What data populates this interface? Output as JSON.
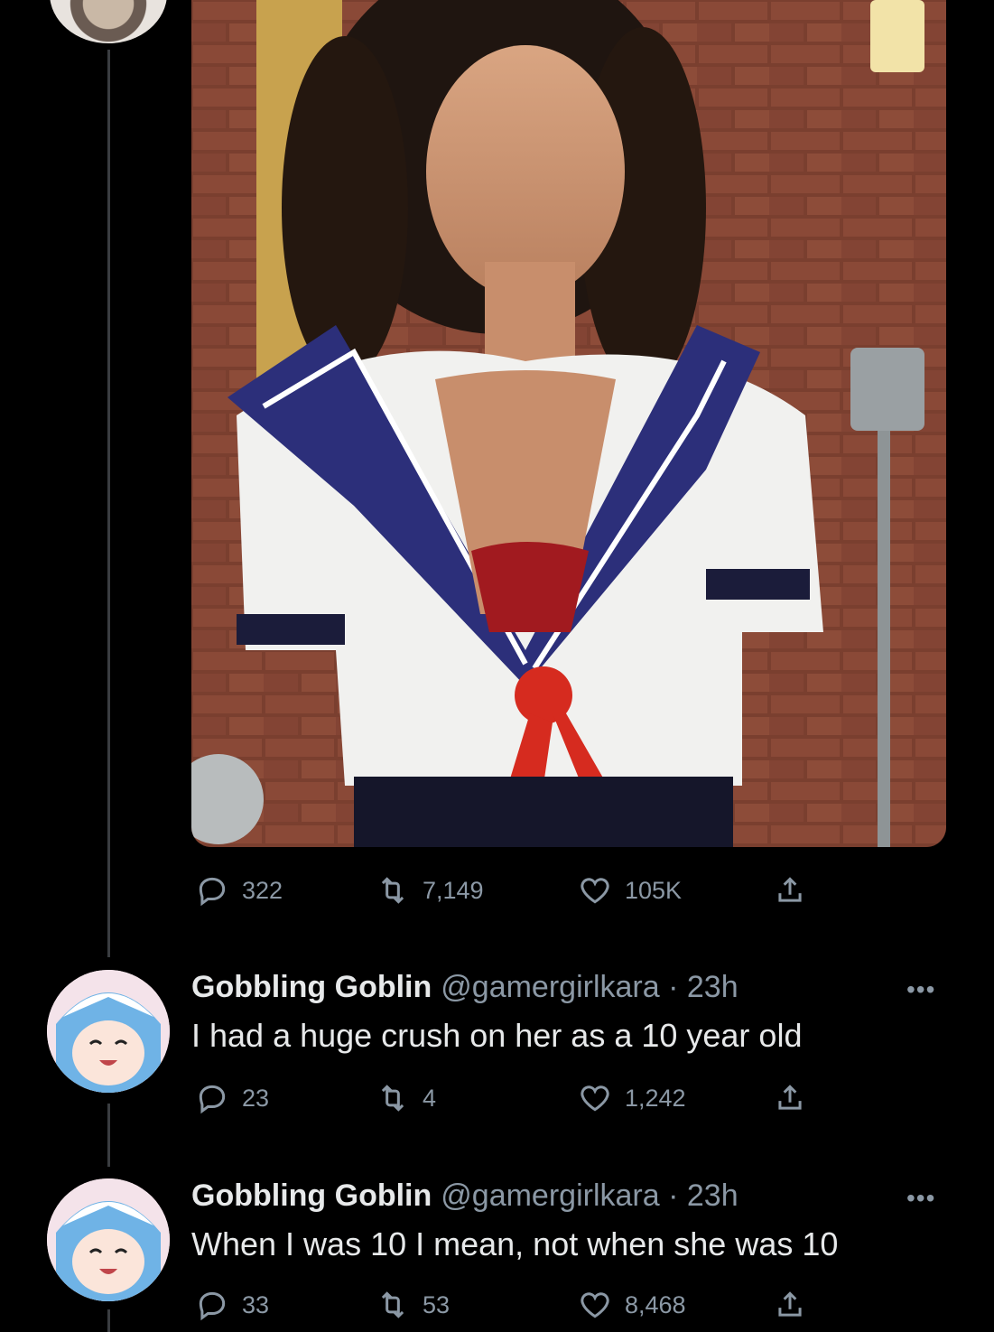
{
  "main_tweet": {
    "stats": {
      "replies": "322",
      "retweets": "7,149",
      "likes": "105K"
    }
  },
  "replies": [
    {
      "name": "Gobbling Goblin",
      "handle": "@gamergirlkara",
      "separator": "·",
      "time": "23h",
      "text": "I had a huge crush on her as a 10 year old",
      "stats": {
        "replies": "23",
        "retweets": "4",
        "likes": "1,242"
      }
    },
    {
      "name": "Gobbling Goblin",
      "handle": "@gamergirlkara",
      "separator": "·",
      "time": "23h",
      "text": "When I was 10 I mean, not when she was 10",
      "stats": {
        "replies": "33",
        "retweets": "53",
        "likes": "8,468"
      }
    }
  ],
  "icons": {
    "reply": "reply-icon",
    "retweet": "retweet-icon",
    "like": "heart-icon",
    "share": "share-icon",
    "more": "more-icon"
  },
  "more_glyph": "•••",
  "colors": {
    "background": "#000000",
    "text": "#e7e9ea",
    "muted": "#8b98a5"
  }
}
